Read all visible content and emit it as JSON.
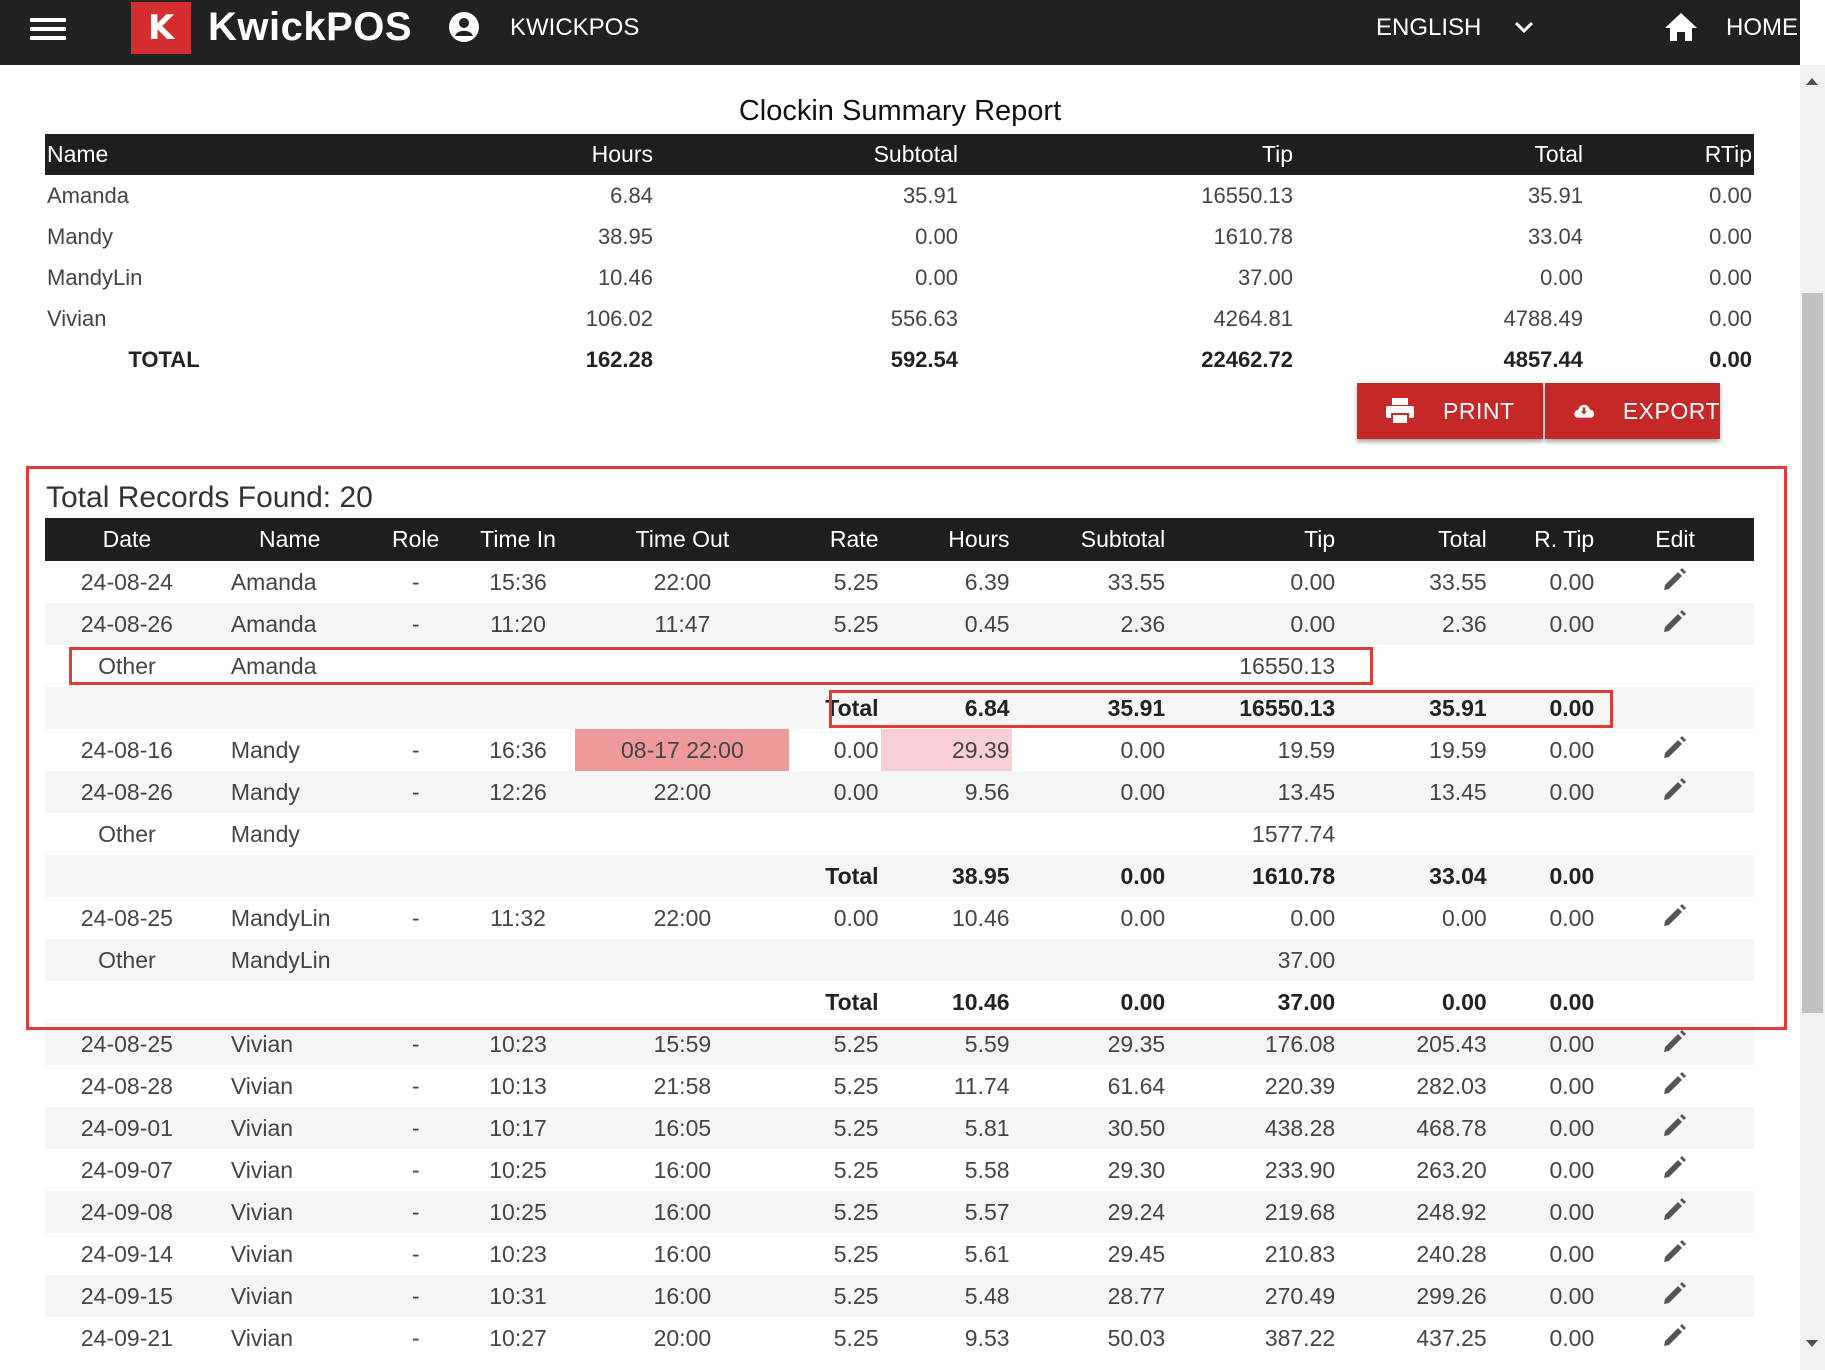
{
  "topbar": {
    "logo_letter": "K",
    "brand": "KwickPOS",
    "account": "KWICKPOS",
    "language": "ENGLISH",
    "home": "HOME"
  },
  "report": {
    "title": "Clockin Summary Report",
    "summary_headers": [
      "Name",
      "Hours",
      "Subtotal",
      "Tip",
      "Total",
      "RTip"
    ],
    "summary_rows": [
      [
        "Amanda",
        "6.84",
        "35.91",
        "16550.13",
        "35.91",
        "0.00"
      ],
      [
        "Mandy",
        "38.95",
        "0.00",
        "1610.78",
        "33.04",
        "0.00"
      ],
      [
        "MandyLin",
        "10.46",
        "0.00",
        "37.00",
        "0.00",
        "0.00"
      ],
      [
        "Vivian",
        "106.02",
        "556.63",
        "4264.81",
        "4788.49",
        "0.00"
      ]
    ],
    "summary_total": [
      "TOTAL",
      "162.28",
      "592.54",
      "22462.72",
      "4857.44",
      "0.00"
    ],
    "print_label": "PRINT",
    "export_label": "EXPORT",
    "records_found": "Total Records Found: 20"
  },
  "records_headers": [
    "Date",
    "Name",
    "Role",
    "Time In",
    "Time Out",
    "Rate",
    "Hours",
    "Subtotal",
    "Tip",
    "Total",
    "R. Tip",
    "Edit"
  ],
  "records": [
    {
      "type": "row",
      "cells": [
        "24-08-24",
        "Amanda",
        "-",
        "15:36",
        "22:00",
        "5.25",
        "6.39",
        "33.55",
        "0.00",
        "33.55",
        "0.00"
      ]
    },
    {
      "type": "row",
      "cells": [
        "24-08-26",
        "Amanda",
        "-",
        "11:20",
        "11:47",
        "5.25",
        "0.45",
        "2.36",
        "0.00",
        "2.36",
        "0.00"
      ]
    },
    {
      "type": "other",
      "cells": [
        "Other",
        "Amanda",
        "",
        "",
        "",
        "",
        "",
        "",
        "16550.13",
        "",
        ""
      ]
    },
    {
      "type": "subtotal",
      "cells": [
        "",
        "",
        "",
        "",
        "",
        "Total",
        "6.84",
        "35.91",
        "16550.13",
        "35.91",
        "0.00"
      ]
    },
    {
      "type": "row",
      "cells": [
        "24-08-16",
        "Mandy",
        "-",
        "16:36",
        "08-17 22:00",
        "0.00",
        "29.39",
        "0.00",
        "19.59",
        "19.59",
        "0.00"
      ],
      "highlight": true
    },
    {
      "type": "row",
      "cells": [
        "24-08-26",
        "Mandy",
        "-",
        "12:26",
        "22:00",
        "0.00",
        "9.56",
        "0.00",
        "13.45",
        "13.45",
        "0.00"
      ]
    },
    {
      "type": "other",
      "cells": [
        "Other",
        "Mandy",
        "",
        "",
        "",
        "",
        "",
        "",
        "1577.74",
        "",
        ""
      ]
    },
    {
      "type": "subtotal",
      "cells": [
        "",
        "",
        "",
        "",
        "",
        "Total",
        "38.95",
        "0.00",
        "1610.78",
        "33.04",
        "0.00"
      ]
    },
    {
      "type": "row",
      "cells": [
        "24-08-25",
        "MandyLin",
        "-",
        "11:32",
        "22:00",
        "0.00",
        "10.46",
        "0.00",
        "0.00",
        "0.00",
        "0.00"
      ]
    },
    {
      "type": "other",
      "cells": [
        "Other",
        "MandyLin",
        "",
        "",
        "",
        "",
        "",
        "",
        "37.00",
        "",
        ""
      ]
    },
    {
      "type": "subtotal",
      "cells": [
        "",
        "",
        "",
        "",
        "",
        "Total",
        "10.46",
        "0.00",
        "37.00",
        "0.00",
        "0.00"
      ]
    },
    {
      "type": "row",
      "cells": [
        "24-08-25",
        "Vivian",
        "-",
        "10:23",
        "15:59",
        "5.25",
        "5.59",
        "29.35",
        "176.08",
        "205.43",
        "0.00"
      ]
    },
    {
      "type": "row",
      "cells": [
        "24-08-28",
        "Vivian",
        "-",
        "10:13",
        "21:58",
        "5.25",
        "11.74",
        "61.64",
        "220.39",
        "282.03",
        "0.00"
      ]
    },
    {
      "type": "row",
      "cells": [
        "24-09-01",
        "Vivian",
        "-",
        "10:17",
        "16:05",
        "5.25",
        "5.81",
        "30.50",
        "438.28",
        "468.78",
        "0.00"
      ]
    },
    {
      "type": "row",
      "cells": [
        "24-09-07",
        "Vivian",
        "-",
        "10:25",
        "16:00",
        "5.25",
        "5.58",
        "29.30",
        "233.90",
        "263.20",
        "0.00"
      ]
    },
    {
      "type": "row",
      "cells": [
        "24-09-08",
        "Vivian",
        "-",
        "10:25",
        "16:00",
        "5.25",
        "5.57",
        "29.24",
        "219.68",
        "248.92",
        "0.00"
      ]
    },
    {
      "type": "row",
      "cells": [
        "24-09-14",
        "Vivian",
        "-",
        "10:23",
        "16:00",
        "5.25",
        "5.61",
        "29.45",
        "210.83",
        "240.28",
        "0.00"
      ]
    },
    {
      "type": "row",
      "cells": [
        "24-09-15",
        "Vivian",
        "-",
        "10:31",
        "16:00",
        "5.25",
        "5.48",
        "28.77",
        "270.49",
        "299.26",
        "0.00"
      ]
    },
    {
      "type": "row",
      "cells": [
        "24-09-21",
        "Vivian",
        "-",
        "10:27",
        "20:00",
        "5.25",
        "9.53",
        "50.03",
        "387.22",
        "437.25",
        "0.00"
      ]
    }
  ],
  "colors": {
    "accent_red": "#c62828",
    "annotation_red": "#e53935",
    "header_dark": "#1e1e1e",
    "highlight_dark": "#ee9a9a",
    "highlight_light": "#f8cfd6"
  }
}
